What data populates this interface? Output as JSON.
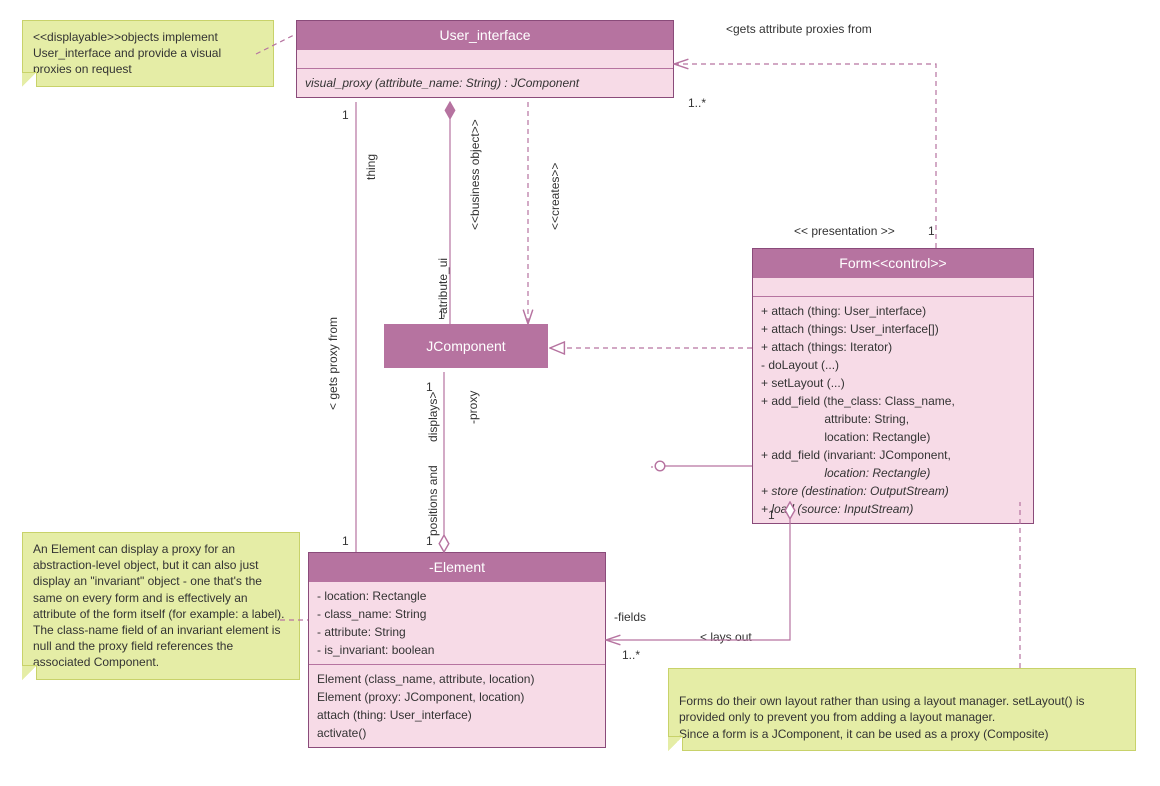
{
  "classes": {
    "user_interface": {
      "title": "User_interface",
      "op1": "visual_proxy (attribute_name: String) : JComponent"
    },
    "jcomponent": {
      "title": "JComponent"
    },
    "form": {
      "title": "Form<<control>>",
      "op1": "+ attach (thing: User_interface)",
      "op2": "+ attach (things: User_interface[])",
      "op3": "+ attach (things: Iterator)",
      "op4": "- doLayout (...)",
      "op5": "+ setLayout (...)",
      "op6": "+ add_field (the_class: Class_name,",
      "op6b": "                   attribute: String,",
      "op6c": "                   location: Rectangle)",
      "op7": "+ add_field (invariant: JComponent,",
      "op7b": "                   location: Rectangle)",
      "op8": "+ store (destination: OutputStream)",
      "op9": "+ load (source: InputStream)"
    },
    "element": {
      "title": "-Element",
      "attr1": "- location: Rectangle",
      "attr2": "- class_name: String",
      "attr3": "- attribute: String",
      "attr4": "- is_invariant: boolean",
      "op1": "Element (class_name, attribute, location)",
      "op2": "Element (proxy: JComponent, location)",
      "op3": "attach (thing: User_interface)",
      "op4": "activate()"
    }
  },
  "notes": {
    "displayable": "<<displayable>>objects implement User_interface and provide a visual proxies on request",
    "element_note": "An Element can display a proxy for an abstraction-level object, but it can also just display an \"invariant\" object - one that's the same on every form and is effectively an attribute of the form itself (for example: a label). The class-name field of an invariant element is null and the proxy field references the associated Component.",
    "form_note": "Forms do their own layout rather than using a layout manager. setLayout() is provided only to prevent you from adding a layout manager.\nSince a form is a JComponent, it can be used as a proxy (Composite)"
  },
  "labels": {
    "gets_attribute_proxies": "<gets attribute proxies from",
    "presentation": "<< presentation >>",
    "one": "1",
    "one_star": "1..*",
    "thing": "thing",
    "business_object": "<<business object>>",
    "creates": "<<creates>>",
    "attribute_ui": "-atribute_ui",
    "gets_proxy_from": "< gets proxy from",
    "proxy": "-proxy",
    "positions_and_displays": "positions and       displays>",
    "fields": "-fields",
    "lays_out": "< lays out"
  }
}
